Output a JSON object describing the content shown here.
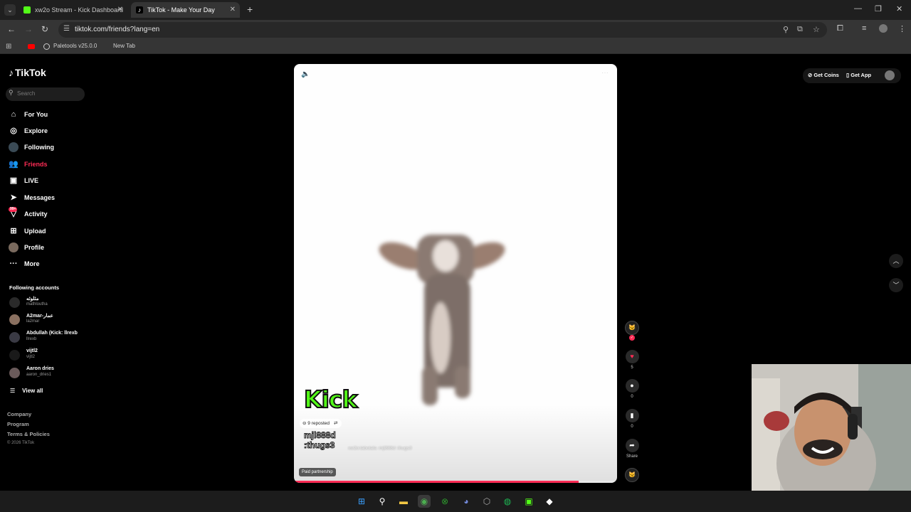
{
  "browser": {
    "tabs": [
      {
        "title": "xw2o Stream - Kick Dashboard",
        "active": false
      },
      {
        "title": "TikTok - Make Your Day",
        "active": true
      }
    ],
    "url": "tiktok.com/friends?lang=en",
    "bookmarks": [
      {
        "label": "Paletools v25.0.0"
      },
      {
        "label": "New Tab"
      }
    ]
  },
  "sidebar": {
    "logo": "TikTok",
    "search_placeholder": "Search",
    "nav": [
      {
        "label": "For You",
        "icon": "home-icon"
      },
      {
        "label": "Explore",
        "icon": "compass-icon"
      },
      {
        "label": "Following",
        "icon": "following-icon"
      },
      {
        "label": "Friends",
        "icon": "friends-icon",
        "active": true
      },
      {
        "label": "LIVE",
        "icon": "live-icon"
      },
      {
        "label": "Messages",
        "icon": "messages-icon"
      },
      {
        "label": "Activity",
        "icon": "activity-icon",
        "badge": "99+"
      },
      {
        "label": "Upload",
        "icon": "upload-icon"
      },
      {
        "label": "Profile",
        "icon": "profile-icon"
      },
      {
        "label": "More",
        "icon": "more-icon"
      }
    ],
    "following_title": "Following accounts",
    "accounts": [
      {
        "name": "مثلوثه",
        "handle": "mathlouthа"
      },
      {
        "name": "A2mar-عمار",
        "handle": "la2mar"
      },
      {
        "name": "Abdullah (Kick: llrexb",
        "handle": "llrexb"
      },
      {
        "name": "vijtl2",
        "handle": "vijtl2"
      },
      {
        "name": "Aaron dries",
        "handle": "aaron_dries1"
      }
    ],
    "view_all": "View all",
    "footer": [
      "Company",
      "Program",
      "Terms & Policies"
    ],
    "copyright": "© 2026 TikTok"
  },
  "video": {
    "overlay_logo": "Kick",
    "reposted": "9 reposted",
    "overlay_text": "mjl888d :thugs3",
    "caption": "xw2o:tabotala :mjl888d :thugs3",
    "paid_label": "Paid partnership",
    "progress": 0.88
  },
  "actions": {
    "likes": "5",
    "comments": "0",
    "saves": "0",
    "share_label": "Share"
  },
  "topbar": {
    "get_coins": "Get Coins",
    "get_app": "Get App"
  },
  "colors": {
    "accent": "#fe2c55",
    "kick_green": "#53fc18"
  }
}
